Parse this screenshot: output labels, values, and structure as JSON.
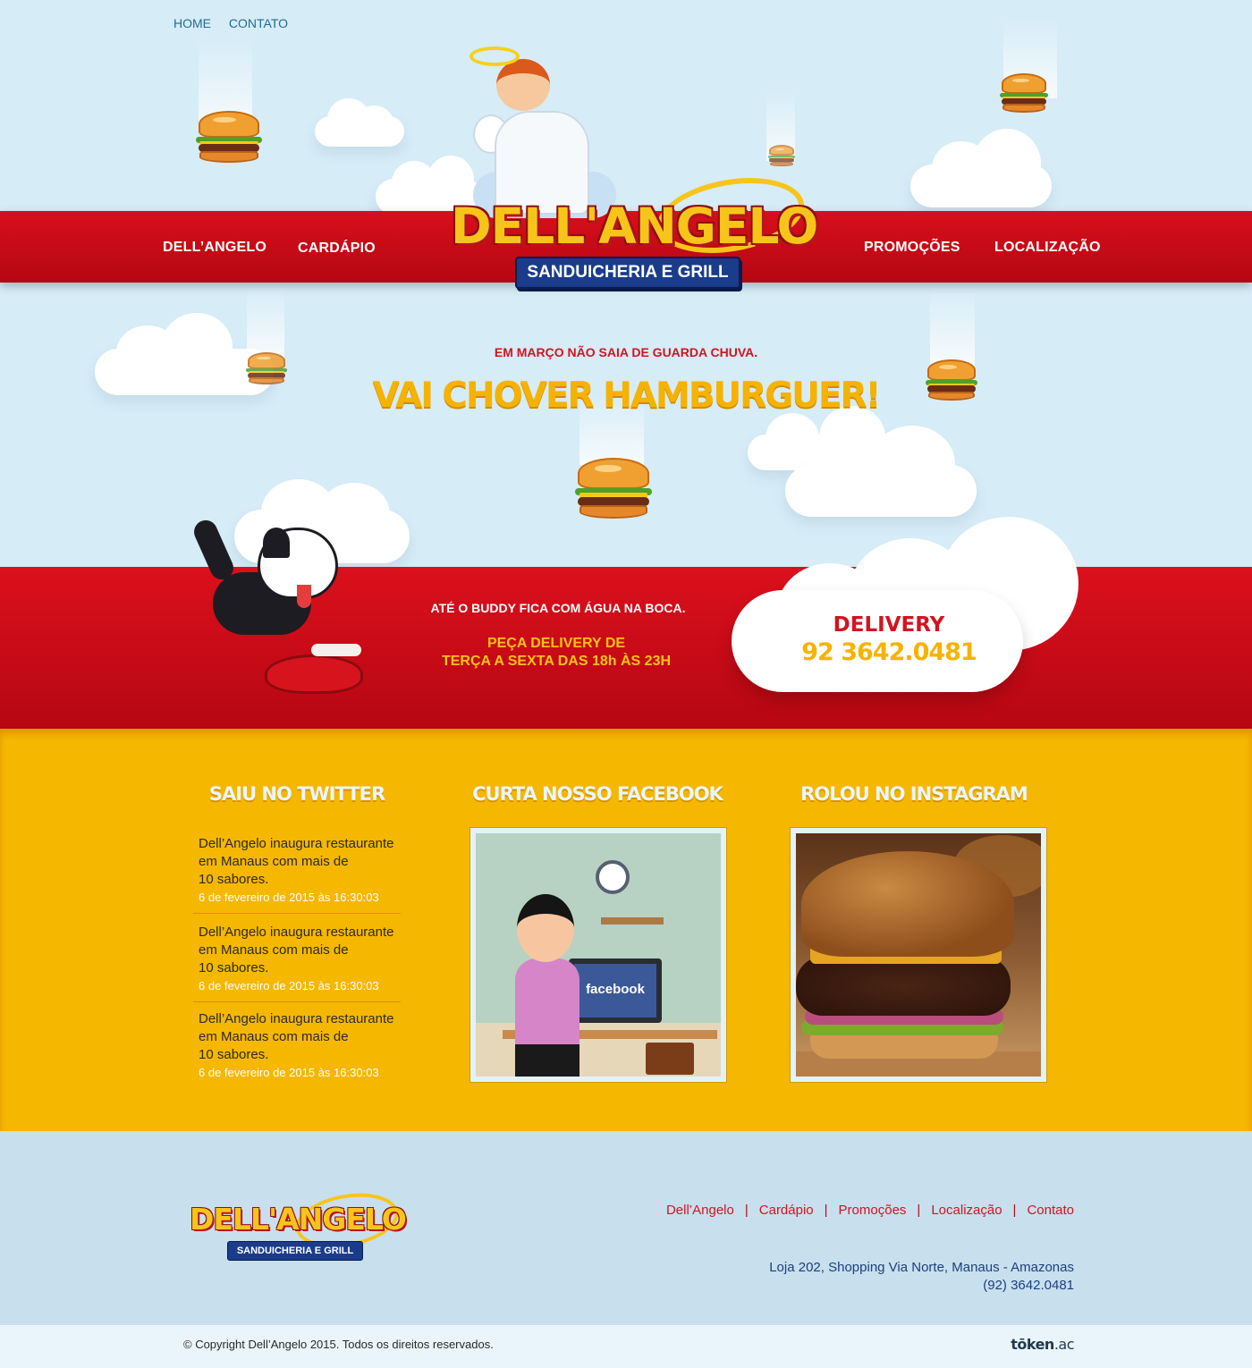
{
  "top_links": [
    "HOME",
    "CONTATO"
  ],
  "nav": {
    "left": [
      "DELL’ANGELO",
      "CARDÁPIO"
    ],
    "right": [
      "PROMOÇÕES",
      "LOCALIZAÇÃO"
    ]
  },
  "logo": {
    "word": "DELL'ANGELO",
    "subtitle": "SANDUICHERIA E GRILL"
  },
  "hero": {
    "kicker": "EM MARÇO NÃO SAIA DE GUARDA CHUVA.",
    "title": "VAI CHOVER HAMBURGUER!"
  },
  "delivery": {
    "buddy_text": "ATÉ O BUDDY FICA COM ÁGUA NA BOCA.",
    "hours_line1": "PEÇA DELIVERY DE",
    "hours_line2": "TERÇA A SEXTA DAS 18h ÀS 23H",
    "label": "DELIVERY",
    "phone": "92 3642.0481"
  },
  "social": {
    "twitter_title": "SAIU NO TWITTER",
    "facebook_title": "CURTA NOSSO FACEBOOK",
    "instagram_title": "ROLOU NO INSTAGRAM",
    "facebook_screen_text": "facebook",
    "tweets": [
      {
        "line1": "Dell’Angelo inaugura restaurante",
        "line2": "em Manaus com mais de",
        "line3": "10 sabores.",
        "date": "6 de fevereiro de 2015 às 16:30:03"
      },
      {
        "line1": "Dell’Angelo inaugura restaurante",
        "line2": "em Manaus com mais de",
        "line3": "10 sabores.",
        "date": "6 de fevereiro de 2015 às 16:30:03"
      },
      {
        "line1": "Dell’Angelo inaugura restaurante",
        "line2": "em Manaus com mais de",
        "line3": "10 sabores.",
        "date": "6 de fevereiro de 2015 às 16:30:03"
      }
    ]
  },
  "footer": {
    "links": [
      "Dell’Angelo",
      "Cardápio",
      "Promoções",
      "Localização",
      "Contato"
    ],
    "separator": "|",
    "address": "Loja 202, Shopping Via Norte, Manaus - Amazonas",
    "phone": "(92) 3642.0481",
    "copyright": "© Copyright Dell’Angelo 2015. Todos os direitos reservados.",
    "agency_bold": "tōken",
    "agency_light": ".ac"
  },
  "colors": {
    "sky": "#d6ecf7",
    "red": "#d80f1c",
    "yellow": "#f6b700",
    "navy": "#1a3c8a"
  }
}
